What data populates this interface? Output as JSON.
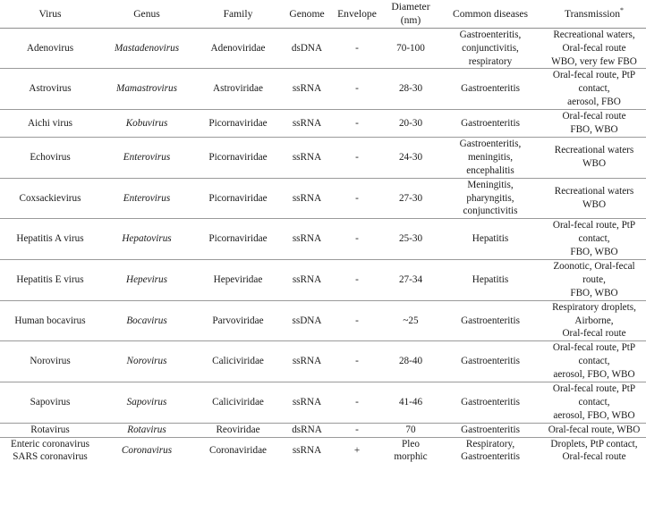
{
  "table": {
    "caption_marker": "*",
    "columns": [
      {
        "key": "virus",
        "label": "Virus"
      },
      {
        "key": "genus",
        "label": "Genus"
      },
      {
        "key": "family",
        "label": "Family"
      },
      {
        "key": "genome",
        "label": "Genome"
      },
      {
        "key": "envelope",
        "label": "Envelope"
      },
      {
        "key": "diameter",
        "label": "Diameter\n(nm)"
      },
      {
        "key": "diseases",
        "label": "Common diseases"
      },
      {
        "key": "transmission",
        "label": "Transmission"
      }
    ],
    "rows": [
      {
        "virus": "Adenovirus",
        "genus": "Mastadenovirus",
        "family": "Adenoviridae",
        "genome": "dsDNA",
        "envelope": "-",
        "diameter": "70-100",
        "diseases": "Gastroenteritis,\nconjunctivitis,\nrespiratory",
        "transmission": "Recreational waters,\nOral-fecal route\nWBO, very few FBO"
      },
      {
        "virus": "Astrovirus",
        "genus": "Mamastrovirus",
        "family": "Astroviridae",
        "genome": "ssRNA",
        "envelope": "-",
        "diameter": "28-30",
        "diseases": "Gastroenteritis",
        "transmission": "Oral-fecal route, PtP contact,\naerosol, FBO"
      },
      {
        "virus": "Aichi virus",
        "genus": "Kobuvirus",
        "family": "Picornaviridae",
        "genome": "ssRNA",
        "envelope": "-",
        "diameter": "20-30",
        "diseases": "Gastroenteritis",
        "transmission": "Oral-fecal route\nFBO, WBO"
      },
      {
        "virus": "Echovirus",
        "genus": "Enterovirus",
        "family": "Picornaviridae",
        "genome": "ssRNA",
        "envelope": "-",
        "diameter": "24-30",
        "diseases": "Gastroenteritis,\nmeningitis,\nencephalitis",
        "transmission": "Recreational waters WBO"
      },
      {
        "virus": "Coxsackievirus",
        "genus": "Enterovirus",
        "family": "Picornaviridae",
        "genome": "ssRNA",
        "envelope": "-",
        "diameter": "27-30",
        "diseases": "Meningitis,\npharyngitis,\nconjunctivitis",
        "transmission": "Recreational waters WBO"
      },
      {
        "virus": "Hepatitis A virus",
        "genus": "Hepatovirus",
        "family": "Picornaviridae",
        "genome": "ssRNA",
        "envelope": "-",
        "diameter": "25-30",
        "diseases": "Hepatitis",
        "transmission": "Oral-fecal route, PtP contact,\nFBO, WBO"
      },
      {
        "virus": "Hepatitis E virus",
        "genus": "Hepevirus",
        "family": "Hepeviridae",
        "genome": "ssRNA",
        "envelope": "-",
        "diameter": "27-34",
        "diseases": "Hepatitis",
        "transmission": "Zoonotic, Oral-fecal route,\nFBO, WBO"
      },
      {
        "virus": "Human bocavirus",
        "genus": "Bocavirus",
        "family": "Parvoviridae",
        "genome": "ssDNA",
        "envelope": "-",
        "diameter": "~25",
        "diseases": "Gastroenteritis",
        "transmission": "Respiratory droplets,\nAirborne,\nOral-fecal route"
      },
      {
        "virus": "Norovirus",
        "genus": "Norovirus",
        "family": "Caliciviridae",
        "genome": "ssRNA",
        "envelope": "-",
        "diameter": "28-40",
        "diseases": "Gastroenteritis",
        "transmission": "Oral-fecal route, PtP contact,\naerosol, FBO, WBO"
      },
      {
        "virus": "Sapovirus",
        "genus": "Sapovirus",
        "family": "Caliciviridae",
        "genome": "ssRNA",
        "envelope": "-",
        "diameter": "41-46",
        "diseases": "Gastroenteritis",
        "transmission": "Oral-fecal route, PtP contact,\naerosol, FBO, WBO"
      },
      {
        "virus": "Rotavirus",
        "genus": "Rotavirus",
        "family": "Reoviridae",
        "genome": "dsRNA",
        "envelope": "-",
        "diameter": "70",
        "diseases": "Gastroenteritis",
        "transmission": "Oral-fecal route, WBO"
      },
      {
        "virus": "Enteric coronavirus\nSARS coronavirus",
        "genus": "Coronavirus",
        "family": "Coronaviridae",
        "genome": "ssRNA",
        "envelope": "+",
        "diameter": "Pleo\nmorphic",
        "diseases": "Respiratory,\nGastroenteritis",
        "transmission": "Droplets, PtP contact,\nOral-fecal route"
      }
    ]
  }
}
